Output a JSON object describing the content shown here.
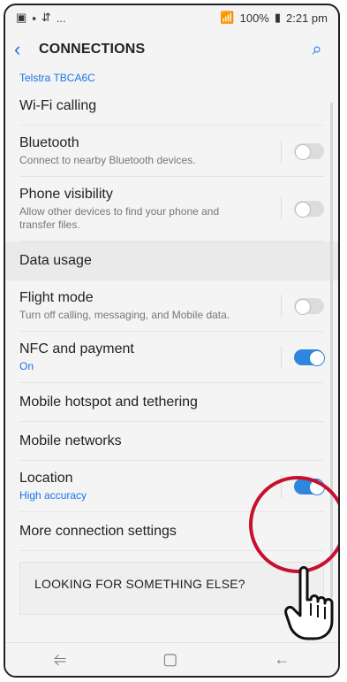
{
  "status": {
    "left_icons": [
      "image-icon",
      "photo-icon",
      "network-icon",
      "more-dots"
    ],
    "battery": "100%",
    "time": "2:21 pm",
    "wifi_signal": "Wi-Fi & signal"
  },
  "header": {
    "back": "<",
    "title": "CONNECTIONS",
    "search": "search"
  },
  "cut_top": "Telstra TBCA6C",
  "rows": [
    {
      "label": "Wi-Fi calling"
    },
    {
      "label": "Bluetooth",
      "sub": "Connect to nearby Bluetooth devices.",
      "toggle": false
    },
    {
      "label": "Phone visibility",
      "sub": "Allow other devices to find your phone and transfer files.",
      "toggle": false
    },
    {
      "label": "Data usage"
    },
    {
      "label": "Flight mode",
      "sub": "Turn off calling, messaging, and Mobile data.",
      "toggle": false
    },
    {
      "label": "NFC and payment",
      "sub": "On",
      "toggle": true
    },
    {
      "label": "Mobile hotspot and tethering"
    },
    {
      "label": "Mobile networks"
    },
    {
      "label": "Location",
      "sub": "High accuracy",
      "toggle": true
    },
    {
      "label": "More connection settings"
    }
  ],
  "looking": "LOOKING FOR SOMETHING ELSE?",
  "nav": {
    "recent": "recent-apps",
    "home": "home",
    "back": "back"
  },
  "colors": {
    "accent": "#1a73e8",
    "toggle_on": "#2e86de",
    "annotation": "#c8102e"
  }
}
